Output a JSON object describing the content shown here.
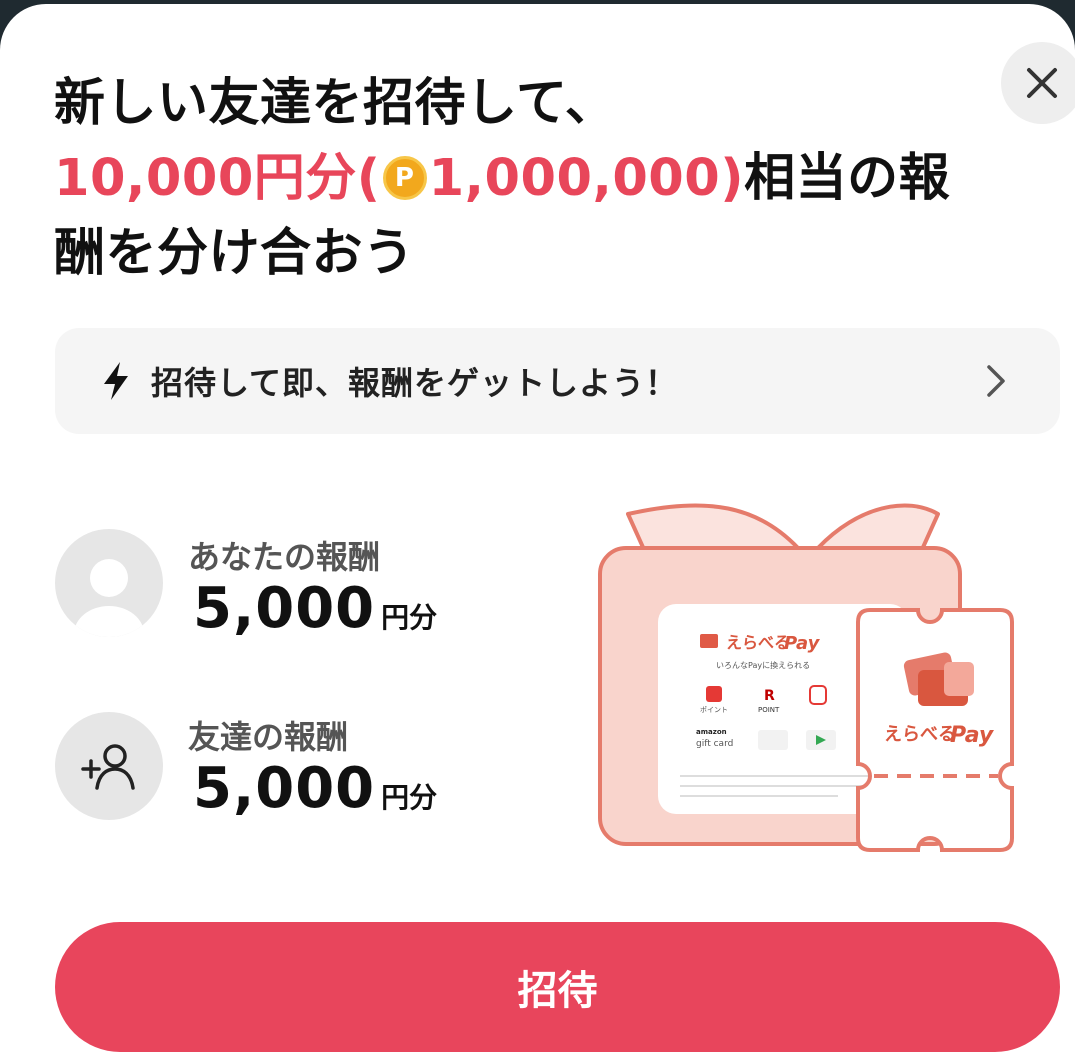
{
  "modal": {
    "title_line1": "新しい友達を招待して、",
    "title_amount": "10,000円分(",
    "coin_symbol": "P",
    "title_points": "1,000,000)",
    "title_tail": "相当の報",
    "title_line3": "酬を分け合おう"
  },
  "banner": {
    "text": "招待して即、報酬をゲットしよう！"
  },
  "rewards": [
    {
      "label": "あなたの報酬",
      "value": "5,000",
      "unit": "円分"
    },
    {
      "label": "友達の報酬",
      "value": "5,000",
      "unit": "円分"
    }
  ],
  "illustration": {
    "brand": "えらべる",
    "brand_pay": "Pay",
    "tagline": "いろんなPayに換えられる",
    "tile_point": "ポイント",
    "tile_rpoint": "POINT",
    "amazon": "amazon",
    "gift_card": "gift card"
  },
  "cta": {
    "label": "招待"
  },
  "colors": {
    "accent": "#e8455c",
    "title_red": "#e8465a",
    "gift": "#f9d4cc",
    "gift_stroke": "#e57b6b"
  }
}
